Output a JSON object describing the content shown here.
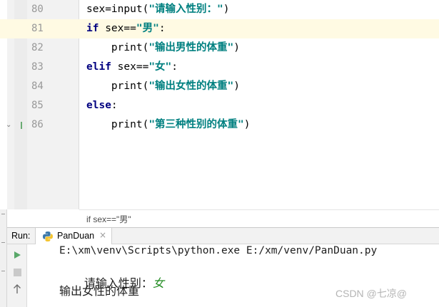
{
  "editor": {
    "lines": [
      {
        "number": "80",
        "indent": "",
        "tokens": [
          {
            "t": "sex=input(",
            "c": ""
          },
          {
            "t": "\"请输入性别：\"",
            "c": "str"
          },
          {
            "t": ")",
            "c": ""
          }
        ]
      },
      {
        "number": "81",
        "indent": "",
        "current": true,
        "tokens": [
          {
            "t": "if",
            "c": "kw"
          },
          {
            "t": " sex==",
            "c": ""
          },
          {
            "t": "\"男\"",
            "c": "str"
          },
          {
            "t": ":",
            "c": ""
          }
        ]
      },
      {
        "number": "82",
        "indent": "    ",
        "tokens": [
          {
            "t": "print(",
            "c": ""
          },
          {
            "t": "\"输出男性的体重\"",
            "c": "str"
          },
          {
            "t": ")",
            "c": ""
          }
        ]
      },
      {
        "number": "83",
        "indent": "",
        "tokens": [
          {
            "t": "elif",
            "c": "kw"
          },
          {
            "t": " sex==",
            "c": ""
          },
          {
            "t": "\"女\"",
            "c": "str"
          },
          {
            "t": ":",
            "c": ""
          }
        ]
      },
      {
        "number": "84",
        "indent": "    ",
        "tokens": [
          {
            "t": "print(",
            "c": ""
          },
          {
            "t": "\"输出女性的体重\"",
            "c": "str"
          },
          {
            "t": ")",
            "c": ""
          }
        ]
      },
      {
        "number": "85",
        "indent": "",
        "tokens": [
          {
            "t": "else",
            "c": "kw"
          },
          {
            "t": ":",
            "c": ""
          }
        ]
      },
      {
        "number": "86",
        "indent": "    ",
        "tokens": [
          {
            "t": "print(",
            "c": ""
          },
          {
            "t": "\"第三种性别的体重\"",
            "c": "str"
          },
          {
            "t": ")",
            "c": ""
          }
        ]
      }
    ],
    "breadcrumb": "if sex==\"男\""
  },
  "run_panel": {
    "label": "Run:",
    "tab_label": "PanDuan",
    "tab_close": "×",
    "console": {
      "command": "E:\\xm\\venv\\Scripts\\python.exe E:/xm/venv/PanDuan.py",
      "prompt": "请输入性别：",
      "user_input": "女",
      "output": "输出女性的体重"
    }
  },
  "icons": {
    "run": "play-icon",
    "stop": "stop-icon",
    "scroll_up": "arrow-up-icon",
    "scroll_down": "arrow-down-icon",
    "python": "python-icon",
    "fold": "fold-arrow-icon"
  },
  "colors": {
    "keyword": "#000080",
    "string": "#008080",
    "current_line": "#fffae3",
    "run_green": "#59a869"
  },
  "watermark": "CSDN @七凉@"
}
